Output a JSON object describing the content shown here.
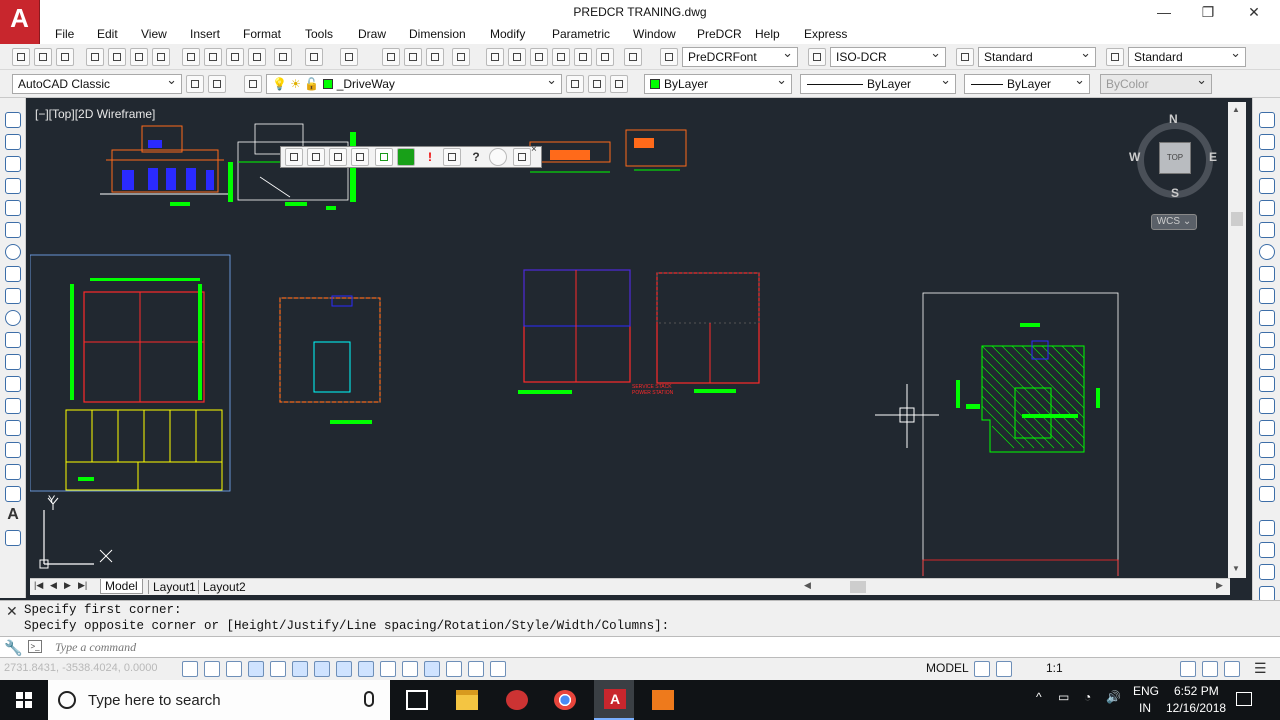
{
  "app": {
    "logo": "A",
    "window_title": "PREDCR TRANING.dwg"
  },
  "window_controls": {
    "minimize": "—",
    "restore": "❐",
    "close": "✕"
  },
  "menubar": {
    "items": [
      "File",
      "Edit",
      "View",
      "Insert",
      "Format",
      "Tools",
      "Draw",
      "Dimension",
      "Modify",
      "Parametric",
      "Window",
      "PreDCR",
      "Help",
      "Express"
    ]
  },
  "toolbar1": {
    "text_style": "PreDCRFont",
    "dim_style": "ISO-DCR",
    "table_style": "Standard",
    "mleader_style": "Standard"
  },
  "toolbar2": {
    "workspace": "AutoCAD Classic",
    "layer": "_DriveWay",
    "color": "ByLayer",
    "linetype": "ByLayer",
    "lineweight": "ByLayer",
    "plot_style": "ByColor"
  },
  "viewport": {
    "label": "[−][Top][2D Wireframe]"
  },
  "viewcube": {
    "north": "N",
    "south": "S",
    "east": "E",
    "west": "W",
    "face": "TOP",
    "wcs": "WCS"
  },
  "ucs": {
    "y": "Y",
    "x": "X"
  },
  "drawing_note": "SERVICE STACK\nPOWER STATION",
  "layout_tabs": {
    "model": "Model",
    "layout1": "Layout1",
    "layout2": "Layout2"
  },
  "command": {
    "history": [
      "Specify first corner:",
      "Specify opposite corner or [Height/Justify/Line spacing/Rotation/Style/Width/Columns]:"
    ],
    "placeholder": "Type a command"
  },
  "status": {
    "coords": "2731.8431, -3538.4024, 0.0000",
    "space": "MODEL",
    "scale": "1:1"
  },
  "taskbar": {
    "search_placeholder": "Type here to search",
    "lang": "ENG",
    "region": "IN",
    "time": "6:52 PM",
    "date": "12/16/2018"
  },
  "colors": {
    "viewport_bg": "#212830",
    "green": "#00ff00",
    "orange": "#ff6a1a",
    "blue": "#2a2aff",
    "red": "#ff2a2a"
  }
}
